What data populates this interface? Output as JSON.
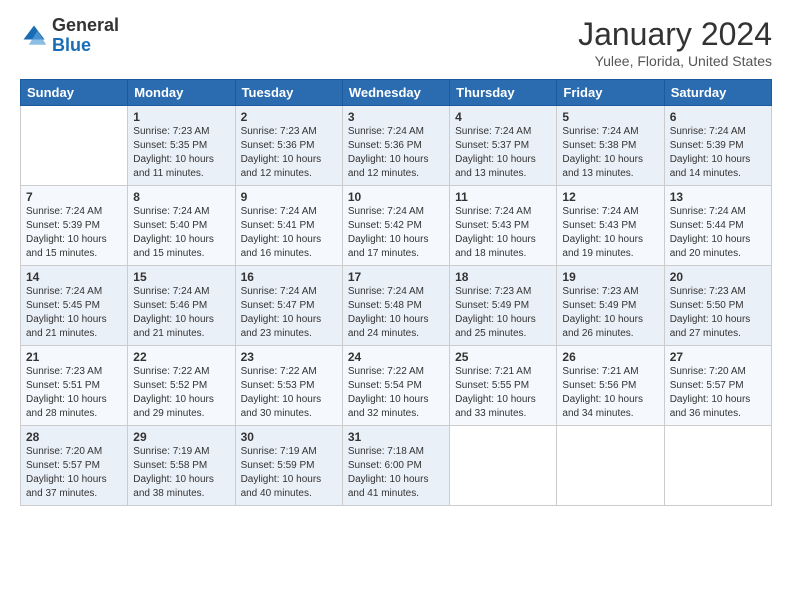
{
  "logo": {
    "general": "General",
    "blue": "Blue"
  },
  "header": {
    "month": "January 2024",
    "location": "Yulee, Florida, United States"
  },
  "weekdays": [
    "Sunday",
    "Monday",
    "Tuesday",
    "Wednesday",
    "Thursday",
    "Friday",
    "Saturday"
  ],
  "weeks": [
    [
      {
        "day": "",
        "info": ""
      },
      {
        "day": "1",
        "info": "Sunrise: 7:23 AM\nSunset: 5:35 PM\nDaylight: 10 hours\nand 11 minutes."
      },
      {
        "day": "2",
        "info": "Sunrise: 7:23 AM\nSunset: 5:36 PM\nDaylight: 10 hours\nand 12 minutes."
      },
      {
        "day": "3",
        "info": "Sunrise: 7:24 AM\nSunset: 5:36 PM\nDaylight: 10 hours\nand 12 minutes."
      },
      {
        "day": "4",
        "info": "Sunrise: 7:24 AM\nSunset: 5:37 PM\nDaylight: 10 hours\nand 13 minutes."
      },
      {
        "day": "5",
        "info": "Sunrise: 7:24 AM\nSunset: 5:38 PM\nDaylight: 10 hours\nand 13 minutes."
      },
      {
        "day": "6",
        "info": "Sunrise: 7:24 AM\nSunset: 5:39 PM\nDaylight: 10 hours\nand 14 minutes."
      }
    ],
    [
      {
        "day": "7",
        "info": "Sunrise: 7:24 AM\nSunset: 5:39 PM\nDaylight: 10 hours\nand 15 minutes."
      },
      {
        "day": "8",
        "info": "Sunrise: 7:24 AM\nSunset: 5:40 PM\nDaylight: 10 hours\nand 15 minutes."
      },
      {
        "day": "9",
        "info": "Sunrise: 7:24 AM\nSunset: 5:41 PM\nDaylight: 10 hours\nand 16 minutes."
      },
      {
        "day": "10",
        "info": "Sunrise: 7:24 AM\nSunset: 5:42 PM\nDaylight: 10 hours\nand 17 minutes."
      },
      {
        "day": "11",
        "info": "Sunrise: 7:24 AM\nSunset: 5:43 PM\nDaylight: 10 hours\nand 18 minutes."
      },
      {
        "day": "12",
        "info": "Sunrise: 7:24 AM\nSunset: 5:43 PM\nDaylight: 10 hours\nand 19 minutes."
      },
      {
        "day": "13",
        "info": "Sunrise: 7:24 AM\nSunset: 5:44 PM\nDaylight: 10 hours\nand 20 minutes."
      }
    ],
    [
      {
        "day": "14",
        "info": "Sunrise: 7:24 AM\nSunset: 5:45 PM\nDaylight: 10 hours\nand 21 minutes."
      },
      {
        "day": "15",
        "info": "Sunrise: 7:24 AM\nSunset: 5:46 PM\nDaylight: 10 hours\nand 21 minutes."
      },
      {
        "day": "16",
        "info": "Sunrise: 7:24 AM\nSunset: 5:47 PM\nDaylight: 10 hours\nand 23 minutes."
      },
      {
        "day": "17",
        "info": "Sunrise: 7:24 AM\nSunset: 5:48 PM\nDaylight: 10 hours\nand 24 minutes."
      },
      {
        "day": "18",
        "info": "Sunrise: 7:23 AM\nSunset: 5:49 PM\nDaylight: 10 hours\nand 25 minutes."
      },
      {
        "day": "19",
        "info": "Sunrise: 7:23 AM\nSunset: 5:49 PM\nDaylight: 10 hours\nand 26 minutes."
      },
      {
        "day": "20",
        "info": "Sunrise: 7:23 AM\nSunset: 5:50 PM\nDaylight: 10 hours\nand 27 minutes."
      }
    ],
    [
      {
        "day": "21",
        "info": "Sunrise: 7:23 AM\nSunset: 5:51 PM\nDaylight: 10 hours\nand 28 minutes."
      },
      {
        "day": "22",
        "info": "Sunrise: 7:22 AM\nSunset: 5:52 PM\nDaylight: 10 hours\nand 29 minutes."
      },
      {
        "day": "23",
        "info": "Sunrise: 7:22 AM\nSunset: 5:53 PM\nDaylight: 10 hours\nand 30 minutes."
      },
      {
        "day": "24",
        "info": "Sunrise: 7:22 AM\nSunset: 5:54 PM\nDaylight: 10 hours\nand 32 minutes."
      },
      {
        "day": "25",
        "info": "Sunrise: 7:21 AM\nSunset: 5:55 PM\nDaylight: 10 hours\nand 33 minutes."
      },
      {
        "day": "26",
        "info": "Sunrise: 7:21 AM\nSunset: 5:56 PM\nDaylight: 10 hours\nand 34 minutes."
      },
      {
        "day": "27",
        "info": "Sunrise: 7:20 AM\nSunset: 5:57 PM\nDaylight: 10 hours\nand 36 minutes."
      }
    ],
    [
      {
        "day": "28",
        "info": "Sunrise: 7:20 AM\nSunset: 5:57 PM\nDaylight: 10 hours\nand 37 minutes."
      },
      {
        "day": "29",
        "info": "Sunrise: 7:19 AM\nSunset: 5:58 PM\nDaylight: 10 hours\nand 38 minutes."
      },
      {
        "day": "30",
        "info": "Sunrise: 7:19 AM\nSunset: 5:59 PM\nDaylight: 10 hours\nand 40 minutes."
      },
      {
        "day": "31",
        "info": "Sunrise: 7:18 AM\nSunset: 6:00 PM\nDaylight: 10 hours\nand 41 minutes."
      },
      {
        "day": "",
        "info": ""
      },
      {
        "day": "",
        "info": ""
      },
      {
        "day": "",
        "info": ""
      }
    ]
  ]
}
